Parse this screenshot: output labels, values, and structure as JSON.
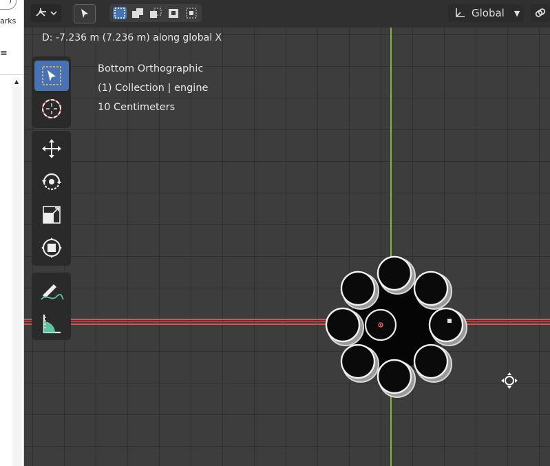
{
  "browser": {
    "bookmarks_fragment": "arks",
    "menu_glyph": "≡",
    "scroll_up": "▲"
  },
  "header": {
    "transform_orientation": "Global",
    "mode_icon": "object-mode-icon",
    "select_tool_icon": "cursor-arrow-icon",
    "selection_modes": [
      "select-new-icon",
      "select-extend-icon",
      "select-subtract-icon",
      "select-invert-icon",
      "select-intersect-icon"
    ],
    "snap_icon": "link-icon"
  },
  "status": {
    "transform_text": "D: -7.236 m (7.236 m) along global X"
  },
  "overlay": {
    "view_name": "Bottom Orthographic",
    "collection": "(1) Collection | engine",
    "grid_scale": "10 Centimeters"
  },
  "toolbar": {
    "tools": [
      "select-box-icon",
      "cursor-icon",
      "move-icon",
      "rotate-icon",
      "scale-icon",
      "transform-icon",
      "annotate-icon",
      "measure-icon"
    ]
  },
  "colors": {
    "viewport_bg": "#3d3d3d",
    "header_bg": "#303030",
    "accent": "#4772b3",
    "x_axis": "#c65a5a",
    "y_axis": "#8bb72a"
  }
}
